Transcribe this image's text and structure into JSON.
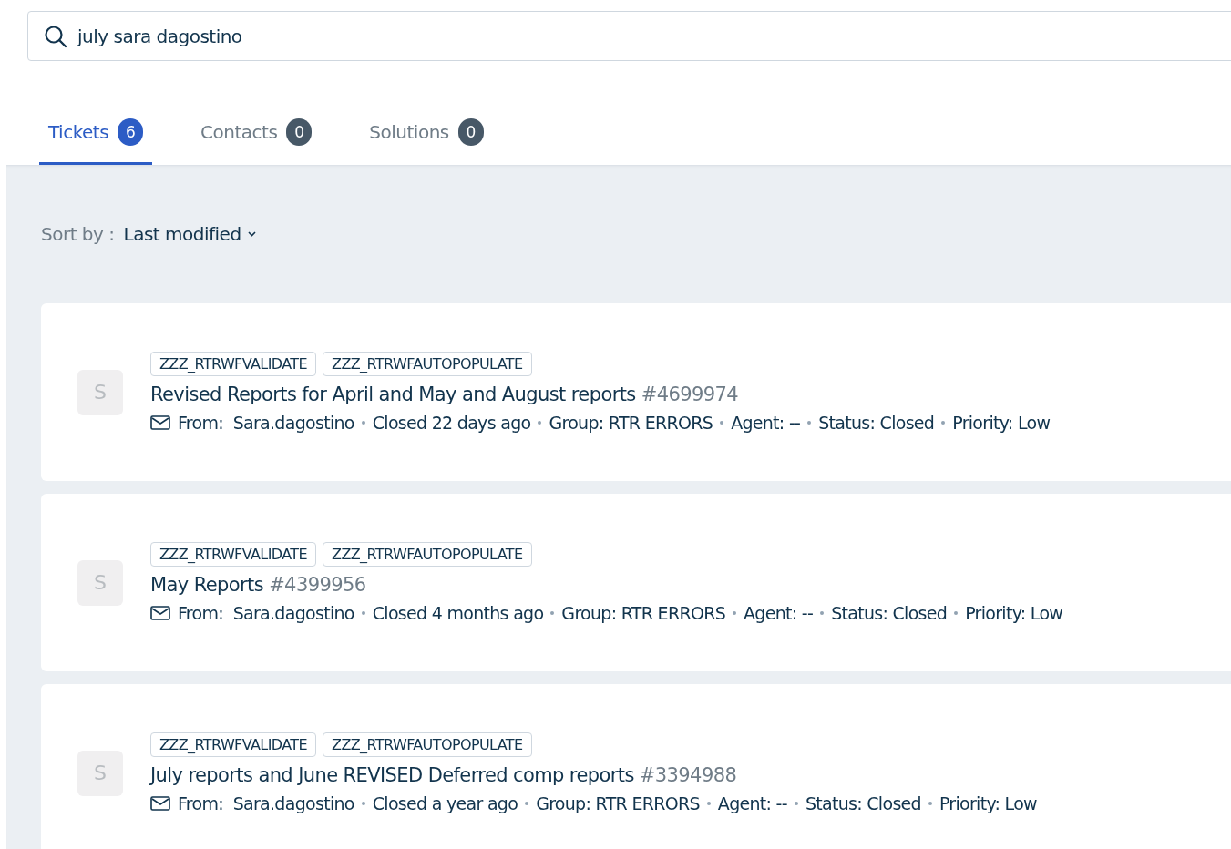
{
  "search": {
    "value": "july sara dagostino"
  },
  "tabs": [
    {
      "label": "Tickets",
      "count": "6",
      "selected": true
    },
    {
      "label": "Contacts",
      "count": "0",
      "selected": false
    },
    {
      "label": "Solutions",
      "count": "0",
      "selected": false
    }
  ],
  "sort": {
    "label": "Sort by :",
    "value": "Last modified"
  },
  "tickets": [
    {
      "avatar": "S",
      "tags": [
        "ZZZ_RTRWFVALIDATE",
        "ZZZ_RTRWFAUTOPOPULATE"
      ],
      "title": "Revised Reports for April and May and August reports",
      "number": "#4699974",
      "meta": [
        "From:  Sara.dagostino",
        "Closed 22 days ago",
        "Group: RTR ERRORS",
        "Agent: --",
        "Status: Closed",
        "Priority: Low"
      ]
    },
    {
      "avatar": "S",
      "tags": [
        "ZZZ_RTRWFVALIDATE",
        "ZZZ_RTRWFAUTOPOPULATE"
      ],
      "title": "May Reports",
      "number": "#4399956",
      "meta": [
        "From:  Sara.dagostino",
        "Closed 4 months ago",
        "Group: RTR ERRORS",
        "Agent: --",
        "Status: Closed",
        "Priority: Low"
      ]
    },
    {
      "avatar": "S",
      "tags": [
        "ZZZ_RTRWFVALIDATE",
        "ZZZ_RTRWFAUTOPOPULATE"
      ],
      "title": "July reports and June REVISED Deferred comp reports",
      "number": "#3394988",
      "meta": [
        "From:  Sara.dagostino",
        "Closed a year ago",
        "Group: RTR ERRORS",
        "Agent: --",
        "Status: Closed",
        "Priority: Low"
      ]
    }
  ]
}
